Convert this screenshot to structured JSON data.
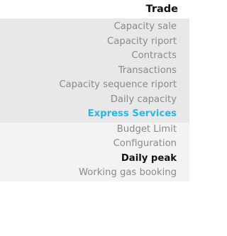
{
  "menu": {
    "title": "Trade",
    "items": [
      {
        "label": "Capacity sale"
      },
      {
        "label": "Capacity riport"
      },
      {
        "label": "Contracts"
      },
      {
        "label": "Transactions"
      },
      {
        "label": "Capacity sequence riport"
      },
      {
        "label": "Daily capacity"
      },
      {
        "label": "Express Services"
      }
    ],
    "subitems": [
      {
        "label": "Budget Limit"
      },
      {
        "label": "Configuration"
      },
      {
        "label": "Daily peak"
      },
      {
        "label": "Working gas booking"
      }
    ]
  },
  "colors": {
    "group_bg": "#e8e8e8",
    "subgroup_bg": "#f3f3f3",
    "text_muted": "#8a8a8a",
    "accent": "#29b6e3",
    "text_dark": "#111111"
  }
}
